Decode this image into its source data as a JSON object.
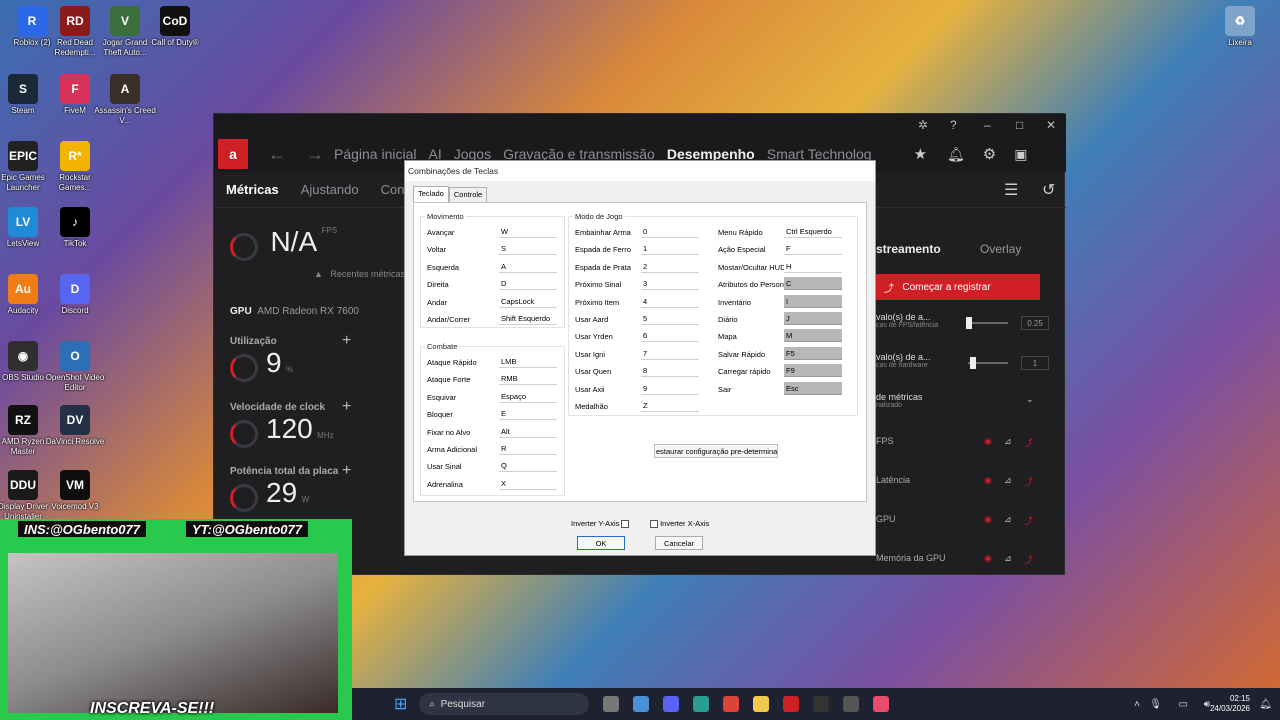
{
  "desktop_icons": [
    {
      "label": "Roblox (2)",
      "color": "#2b68e8",
      "glyph": "R"
    },
    {
      "label": "Red Dead Redempti...",
      "color": "#8b1a1a",
      "glyph": "RD"
    },
    {
      "label": "Jogar Grand Theft Auto...",
      "color": "#3a6e3a",
      "glyph": "V"
    },
    {
      "label": "Call of Duty®",
      "color": "#111111",
      "glyph": "CoD"
    },
    {
      "label": "Steam",
      "color": "#1b2838",
      "glyph": "S"
    },
    {
      "label": "FiveM",
      "color": "#d8325a",
      "glyph": "F"
    },
    {
      "label": "Assassin's Creed V...",
      "color": "#3a2f27",
      "glyph": "A"
    },
    {
      "label": "Epic Games Launcher",
      "color": "#222222",
      "glyph": "EPIC"
    },
    {
      "label": "Rockstar Games...",
      "color": "#f2b400",
      "glyph": "R*"
    },
    {
      "label": "LetsView",
      "color": "#1f8ad6",
      "glyph": "LV"
    },
    {
      "label": "TikTok",
      "color": "#000000",
      "glyph": "♪"
    },
    {
      "label": "Audacity",
      "color": "#f07c16",
      "glyph": "Au"
    },
    {
      "label": "Discord",
      "color": "#5865f2",
      "glyph": "D"
    },
    {
      "label": "OBS Studio",
      "color": "#302e31",
      "glyph": "◉"
    },
    {
      "label": "OpenShot Video Editor",
      "color": "#2d6fb7",
      "glyph": "O"
    },
    {
      "label": "AMD Ryzen Master",
      "color": "#111111",
      "glyph": "RZ"
    },
    {
      "label": "DaVinci Resolve",
      "color": "#233046",
      "glyph": "DV"
    },
    {
      "label": "Display Driver Uninstaller",
      "color": "#1a1a1a",
      "glyph": "DDU"
    },
    {
      "label": "Voicemod V3",
      "color": "#0e0e0e",
      "glyph": "VM"
    },
    {
      "label": "Lixeira",
      "color": "#7fa4c9",
      "glyph": "♻"
    }
  ],
  "amd_window": {
    "logo": "a",
    "nav_items": [
      "Página inicial",
      "AI",
      "Jogos",
      "Gravação e transmissão",
      "Desempenho",
      "Smart Technolog"
    ],
    "active_nav": "Desempenho",
    "sub_items": [
      "Métricas",
      "Ajustando",
      "Config"
    ],
    "fps_value": "N/A",
    "fps_unit": "FPS",
    "recent_metrics": "Recentes métricas",
    "gpu_label": "GPU",
    "gpu_name": "AMD Radeon RX 7600",
    "metrics": [
      {
        "label": "Utilização",
        "value": "9",
        "unit": "%"
      },
      {
        "label": "Velocidade de clock",
        "value": "120",
        "unit": "MHz"
      },
      {
        "label": "Potência total da placa",
        "value": "29",
        "unit": "W"
      }
    ],
    "right_tabs": [
      "streamento",
      "Overlay"
    ],
    "record_button": "Começar a registrar",
    "right_rows": [
      {
        "title": "valo(s) de a...",
        "sub": "cas de FPS/latência",
        "value": "0.25"
      },
      {
        "title": "valo(s) de a...",
        "sub": "cas de hardware",
        "value": "1"
      }
    ],
    "metric_group": "de métricas",
    "metric_group_sub": "nalizado",
    "metric_list": [
      "FPS",
      "Latência",
      "GPU",
      "Memória da GPU"
    ]
  },
  "dialog": {
    "title": "Combinações de Teclas",
    "tabs": [
      "Teclado",
      "Controle"
    ],
    "movement": {
      "title": "Movimento",
      "rows": [
        {
          "label": "Avançar",
          "key": "W"
        },
        {
          "label": "Voltar",
          "key": "S"
        },
        {
          "label": "Esquerda",
          "key": "A"
        },
        {
          "label": "Direita",
          "key": "D"
        },
        {
          "label": "Andar",
          "key": "CapsLock"
        },
        {
          "label": "Andar/Correr",
          "key": "Shift Esquerdo"
        }
      ]
    },
    "combat": {
      "title": "Combate",
      "rows": [
        {
          "label": "Ataque Rápido",
          "key": "LMB"
        },
        {
          "label": "Ataque Forte",
          "key": "RMB"
        },
        {
          "label": "Esquivar",
          "key": "Espaço"
        },
        {
          "label": "Bloquer",
          "key": "E"
        },
        {
          "label": "Fixar no Alvo",
          "key": "Alt"
        },
        {
          "label": "Arma Adicional",
          "key": "R"
        },
        {
          "label": "Usar Sinal",
          "key": "Q"
        },
        {
          "label": "Adrenalina",
          "key": "X"
        }
      ]
    },
    "game_mode": {
      "title": "Modo de Jogo",
      "col1": [
        {
          "label": "Embainhar Arma",
          "key": "0"
        },
        {
          "label": "Espada de Ferro",
          "key": "1"
        },
        {
          "label": "Espada de Prata",
          "key": "2"
        },
        {
          "label": "Próximo Sinal",
          "key": "3"
        },
        {
          "label": "Próximo Item",
          "key": "4"
        },
        {
          "label": "Usar Aard",
          "key": "5"
        },
        {
          "label": "Usar Yrden",
          "key": "6"
        },
        {
          "label": "Usar Igni",
          "key": "7"
        },
        {
          "label": "Usar Quen",
          "key": "8"
        },
        {
          "label": "Usar Axii",
          "key": "9"
        },
        {
          "label": "Medalhão",
          "key": "Z"
        }
      ],
      "col2": [
        {
          "label": "Menu Rápido",
          "key": "Ctrl Esquerdo",
          "disabled": false
        },
        {
          "label": "Ação Especial",
          "key": "F",
          "disabled": false
        },
        {
          "label": "Mostar/Ocultar HUD",
          "key": "H",
          "disabled": false
        },
        {
          "label": "Atributos do Person",
          "key": "C",
          "disabled": true
        },
        {
          "label": "Inventário",
          "key": "I",
          "disabled": true
        },
        {
          "label": "Diário",
          "key": "J",
          "disabled": true
        },
        {
          "label": "Mapa",
          "key": "M",
          "disabled": true
        },
        {
          "label": "Salvar Rápido",
          "key": "F5",
          "disabled": true
        },
        {
          "label": "Carregar rápido",
          "key": "F9",
          "disabled": true
        },
        {
          "label": "Sair",
          "key": "Esc",
          "disabled": true
        }
      ]
    },
    "restore_button": "estaurar configuração pre-determinac",
    "invert_y": "Inverter Y-Axis",
    "invert_x": "Inverter X-Axis",
    "ok": "OK",
    "cancel": "Cancelar"
  },
  "overlay": {
    "instagram": "INS:@OGbento077",
    "youtube": "YT:@OGbento077",
    "banner": "INSCREVA-SE!!!"
  },
  "taskbar": {
    "search_placeholder": "Pesquisar",
    "time": "02:15",
    "date": "24/03/2026"
  }
}
